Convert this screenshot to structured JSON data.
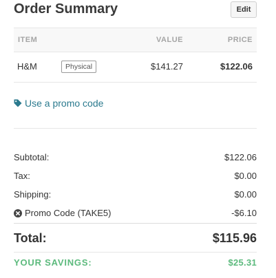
{
  "header": {
    "title": "Order Summary",
    "edit_label": "Edit"
  },
  "table": {
    "columns": {
      "item": "ITEM",
      "value": "VALUE",
      "price": "PRICE"
    },
    "rows": [
      {
        "name": "H&M",
        "type": "Physical",
        "value": "$141.27",
        "price": "$122.06"
      }
    ]
  },
  "promo": {
    "link_text": "Use a promo code",
    "icon": "tag-icon"
  },
  "summary": {
    "subtotal_label": "Subtotal:",
    "subtotal": "$122.06",
    "tax_label": "Tax:",
    "tax": "$0.00",
    "shipping_label": "Shipping:",
    "shipping": "$0.00",
    "promo_label": "Promo Code (TAKE5)",
    "promo_value": "-$6.10",
    "total_label": "Total:",
    "total": "$115.96",
    "savings_label": "YOUR SAVINGS:",
    "savings": "$25.31"
  },
  "colors": {
    "accent_link": "#2b7a8e",
    "savings": "#5cba7d"
  }
}
